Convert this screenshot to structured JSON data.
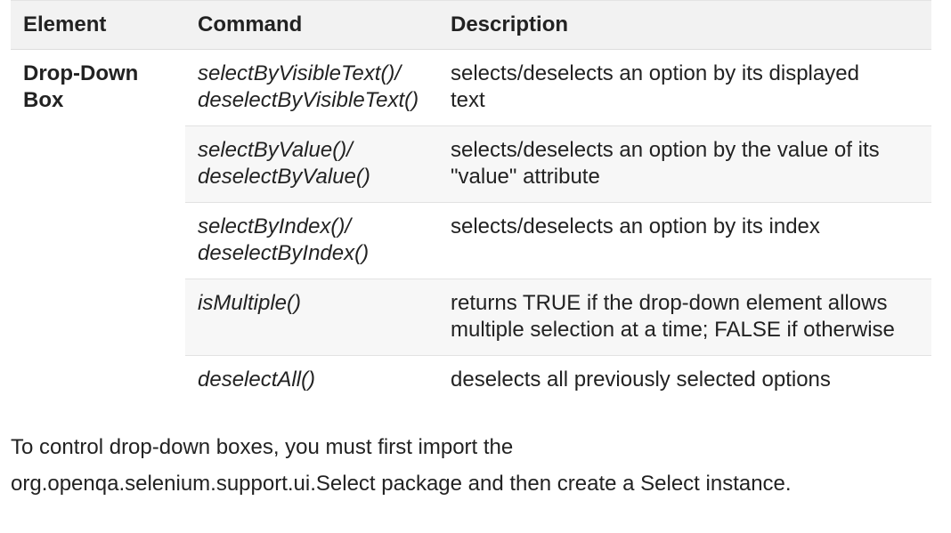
{
  "table": {
    "headers": {
      "element": "Element",
      "command": "Command",
      "description": "Description"
    },
    "element_label_line1": "Drop-Down",
    "element_label_line2": "Box",
    "rows": [
      {
        "command_line1": "selectByVisibleText()/",
        "command_line2": "deselectByVisibleText()",
        "description_line1": "selects/deselects an option by its displayed",
        "description_line2": "text"
      },
      {
        "command_line1": "selectByValue()/",
        "command_line2": "deselectByValue()",
        "description_line1": "selects/deselects an option by the value of its",
        "description_line2": "\"value\" attribute"
      },
      {
        "command_line1": "selectByIndex()/",
        "command_line2": "deselectByIndex()",
        "description_line1": "selects/deselects an option by its index",
        "description_line2": ""
      },
      {
        "command_line1": "isMultiple()",
        "command_line2": "",
        "description_line1": "returns TRUE if the drop-down element allows",
        "description_line2": "multiple selection at a time; FALSE if otherwise"
      },
      {
        "command_line1": "deselectAll()",
        "command_line2": "",
        "description_line1": "deselects all previously selected options",
        "description_line2": ""
      }
    ]
  },
  "paragraph": {
    "line1": "To control drop-down boxes, you must first import the",
    "line2": "org.openqa.selenium.support.ui.Select package and then create a Select instance."
  }
}
